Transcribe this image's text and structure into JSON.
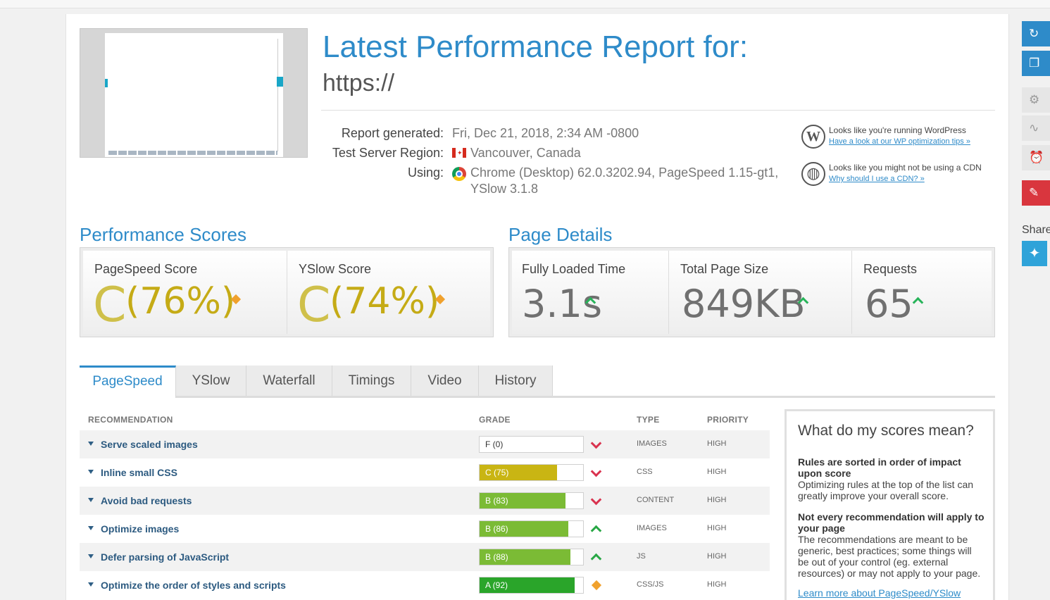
{
  "header": {
    "title": "Latest Performance Report for:",
    "url": "https://"
  },
  "report_meta": {
    "generated_label": "Report generated:",
    "generated_value": "Fri, Dec 21, 2018, 2:34 AM -0800",
    "region_label": "Test Server Region:",
    "region_value": "Vancouver, Canada",
    "using_label": "Using:",
    "using_value_line1": "Chrome (Desktop) 62.0.3202.94, PageSpeed 1.15-gt1,",
    "using_value_line2": "YSlow 3.1.8"
  },
  "notices": [
    {
      "text": "Looks like you're running WordPress",
      "link": "Have a look at our WP optimization tips »",
      "icon": "wordpress-icon"
    },
    {
      "text": "Looks like you might not be using a CDN",
      "link": "Why should I use a CDN? »",
      "icon": "globe-icon"
    }
  ],
  "performance_scores": {
    "title": "Performance Scores",
    "pagespeed": {
      "label": "PageSpeed Score",
      "grade": "C",
      "pct": "(76%)"
    },
    "yslow": {
      "label": "YSlow Score",
      "grade": "C",
      "pct": "(74%)"
    }
  },
  "page_details": {
    "title": "Page Details",
    "loaded": {
      "label": "Fully Loaded Time",
      "value": "3.1s"
    },
    "size": {
      "label": "Total Page Size",
      "value": "849KB"
    },
    "requests": {
      "label": "Requests",
      "value": "65"
    }
  },
  "tabs": [
    "PageSpeed",
    "YSlow",
    "Waterfall",
    "Timings",
    "Video",
    "History"
  ],
  "active_tab": "PageSpeed",
  "table": {
    "headers": {
      "recommendation": "RECOMMENDATION",
      "grade": "GRADE",
      "type": "TYPE",
      "priority": "PRIORITY"
    },
    "rows": [
      {
        "name": "Serve scaled images",
        "grade": "F (0)",
        "score": 0,
        "type": "IMAGES",
        "priority": "HIGH",
        "trend": "down"
      },
      {
        "name": "Inline small CSS",
        "grade": "C (75)",
        "score": 75,
        "type": "CSS",
        "priority": "HIGH",
        "trend": "down"
      },
      {
        "name": "Avoid bad requests",
        "grade": "B (83)",
        "score": 83,
        "type": "CONTENT",
        "priority": "HIGH",
        "trend": "down"
      },
      {
        "name": "Optimize images",
        "grade": "B (86)",
        "score": 86,
        "type": "IMAGES",
        "priority": "HIGH",
        "trend": "up"
      },
      {
        "name": "Defer parsing of JavaScript",
        "grade": "B (88)",
        "score": 88,
        "type": "JS",
        "priority": "HIGH",
        "trend": "up"
      },
      {
        "name": "Optimize the order of styles and scripts",
        "grade": "A (92)",
        "score": 92,
        "type": "CSS/JS",
        "priority": "HIGH",
        "trend": "neutral"
      }
    ]
  },
  "info_box": {
    "title": "What do my scores mean?",
    "p1_bold": "Rules are sorted in order of impact upon score",
    "p1_text": "Optimizing rules at the top of the list can greatly improve your overall score.",
    "p2_bold": "Not every recommendation will apply to your page",
    "p2_text": "The recommendations are meant to be generic, best practices; some things will be out of your control (eg. external resources) or may not apply to your page.",
    "link": "Learn more about PageSpeed/YSlow"
  },
  "sidebar": {
    "share_label": "Share",
    "buttons": [
      {
        "icon": "refresh-icon",
        "color": "#2e8bc9",
        "glyph": "↻"
      },
      {
        "icon": "copy-icon",
        "color": "#2e8bc9",
        "glyph": "❐"
      },
      {
        "icon": "gear-icon",
        "color": "#e6e6e6",
        "glyph": "⚙"
      },
      {
        "icon": "pulse-icon",
        "color": "#e6e6e6",
        "glyph": "∿"
      },
      {
        "icon": "alarm-icon",
        "color": "#e6e6e6",
        "glyph": "⏰"
      },
      {
        "icon": "pdf-icon",
        "color": "#d9363e",
        "glyph": "✎"
      }
    ]
  },
  "colors": {
    "accent": "#2e8bc9",
    "grade_c": "#c9b513",
    "grade_b": "#7bbb35",
    "grade_a": "#2aa52a",
    "trend_up": "#28a745",
    "trend_down": "#d9334f",
    "neutral": "#f0a12d"
  }
}
